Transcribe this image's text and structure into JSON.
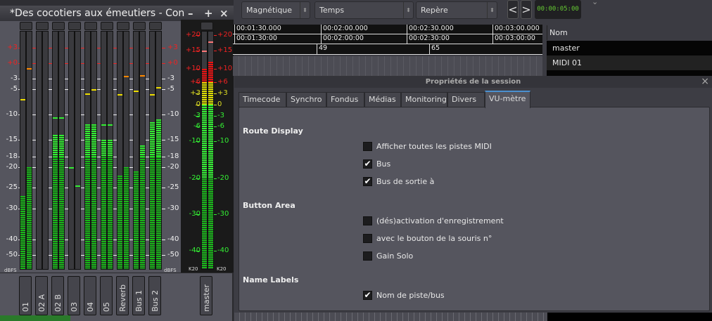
{
  "mixer": {
    "title": "*Des cocotiers aux émeutiers - Con",
    "min": "–",
    "max": "+",
    "close": "×",
    "scale_unit": "dBFS",
    "master_scale_unit": "K20",
    "scale": [
      {
        "db": 3,
        "label": "+3",
        "c": "red"
      },
      {
        "db": 0,
        "label": "+0",
        "c": "red"
      },
      {
        "db": -3,
        "label": "-3",
        "c": "w"
      },
      {
        "db": -5,
        "label": "-5",
        "c": "w"
      },
      {
        "db": -10,
        "label": "-10",
        "c": "w"
      },
      {
        "db": -15,
        "label": "-15",
        "c": "w"
      },
      {
        "db": -18,
        "label": "-18",
        "c": "w"
      },
      {
        "db": -20,
        "label": "-20",
        "c": "w"
      },
      {
        "db": -25,
        "label": "-25",
        "c": "w"
      },
      {
        "db": -30,
        "label": "-30",
        "c": "w"
      },
      {
        "db": -40,
        "label": "-40",
        "c": "w"
      },
      {
        "db": -50,
        "label": "-50",
        "c": "w"
      }
    ],
    "master_scale": [
      {
        "db": 20,
        "label": "+20",
        "c": "red"
      },
      {
        "db": 15,
        "label": "+15",
        "c": "red"
      },
      {
        "db": 10,
        "label": "+10",
        "c": "red"
      },
      {
        "db": 6,
        "label": "+6",
        "c": "red"
      },
      {
        "db": 3,
        "label": "+3",
        "c": "yel"
      },
      {
        "db": 0,
        "label": "0",
        "c": "yel"
      },
      {
        "db": -3,
        "label": "-3",
        "c": "grn"
      },
      {
        "db": -6,
        "label": "-6",
        "c": "grn"
      },
      {
        "db": -10,
        "label": "-10",
        "c": "grn"
      },
      {
        "db": -20,
        "label": "-20",
        "c": "grn"
      },
      {
        "db": -30,
        "label": "-30",
        "c": "grn"
      },
      {
        "db": -40,
        "label": "-40",
        "c": "grn"
      }
    ],
    "strips": [
      {
        "name": "01",
        "level": [
          -27,
          -20
        ],
        "peak": [
          -7,
          -1
        ]
      },
      {
        "name": "02 A",
        "level": [
          -80,
          -80
        ],
        "peak": [
          null,
          null
        ]
      },
      {
        "name": "02 B",
        "level": [
          -14,
          -14
        ],
        "peak": [
          -10.5,
          -10.5
        ]
      },
      {
        "name": "03",
        "level": [
          -80,
          -80
        ],
        "peak": [
          -20,
          -24.5
        ]
      },
      {
        "name": "04",
        "level": [
          -12,
          -12
        ],
        "peak": [
          -5.8,
          -5
        ]
      },
      {
        "name": "05",
        "level": [
          -15,
          -15
        ],
        "peak": [
          -12,
          -12
        ]
      },
      {
        "name": "Reverb",
        "level": [
          -22,
          -20
        ],
        "peak": [
          -6,
          -2.5
        ]
      },
      {
        "name": "Bus 1",
        "level": [
          -21,
          -16
        ],
        "peak": [
          -5.3,
          -2.3
        ]
      },
      {
        "name": "Bus 2",
        "level": [
          -11.5,
          -11
        ],
        "peak": [
          -6,
          -4.6
        ]
      }
    ],
    "master": {
      "name": "master",
      "level": [
        10,
        12
      ],
      "peak": [
        15,
        18
      ]
    }
  },
  "toolbar": {
    "snap": "Magnétique",
    "mode": "Temps",
    "marker": "Repère",
    "prev": "<",
    "next": ">",
    "clock": "00:00:05:00",
    "expand": "⌄"
  },
  "ruler": {
    "timecode": [
      "00:01:30.000",
      "00:02:00.000",
      "00:02:30.000",
      "00:03:00.000"
    ],
    "minsec": [
      "00:01:30:00",
      "00:02:00:00",
      "00:02:30:00",
      "00:03:00:00"
    ],
    "bars": [
      "49",
      "65"
    ]
  },
  "tracks": {
    "header": "Nom",
    "rows": [
      "master",
      "MIDI 01"
    ]
  },
  "dialog": {
    "title": "Propriétés de la session",
    "close": "×",
    "tabs": [
      "Timecode",
      "Synchro",
      "Fondus",
      "Médias",
      "Monitoring",
      "Divers",
      "VU-mètre"
    ],
    "active_tab": 6,
    "sections": [
      {
        "title": "Route Display",
        "options": [
          {
            "label": "Afficher toutes les pistes MIDI",
            "checked": false
          },
          {
            "label": "Bus",
            "checked": true
          },
          {
            "label": "Bus de sortie à",
            "checked": true
          }
        ]
      },
      {
        "title": "Button Area",
        "options": [
          {
            "label": "(dés)activation d'enregistrement",
            "checked": false
          },
          {
            "label": "avec le bouton de la souris n°",
            "checked": false
          },
          {
            "label": "Gain Solo",
            "checked": false
          }
        ]
      },
      {
        "title": "Name Labels",
        "options": [
          {
            "label": "Nom de piste/bus",
            "checked": true
          }
        ]
      }
    ]
  },
  "colors": {
    "green": "#22cc22",
    "bright_green": "#44ff44",
    "red": "#ee1111",
    "yellow": "#dddd00",
    "orange": "#ff8800"
  }
}
